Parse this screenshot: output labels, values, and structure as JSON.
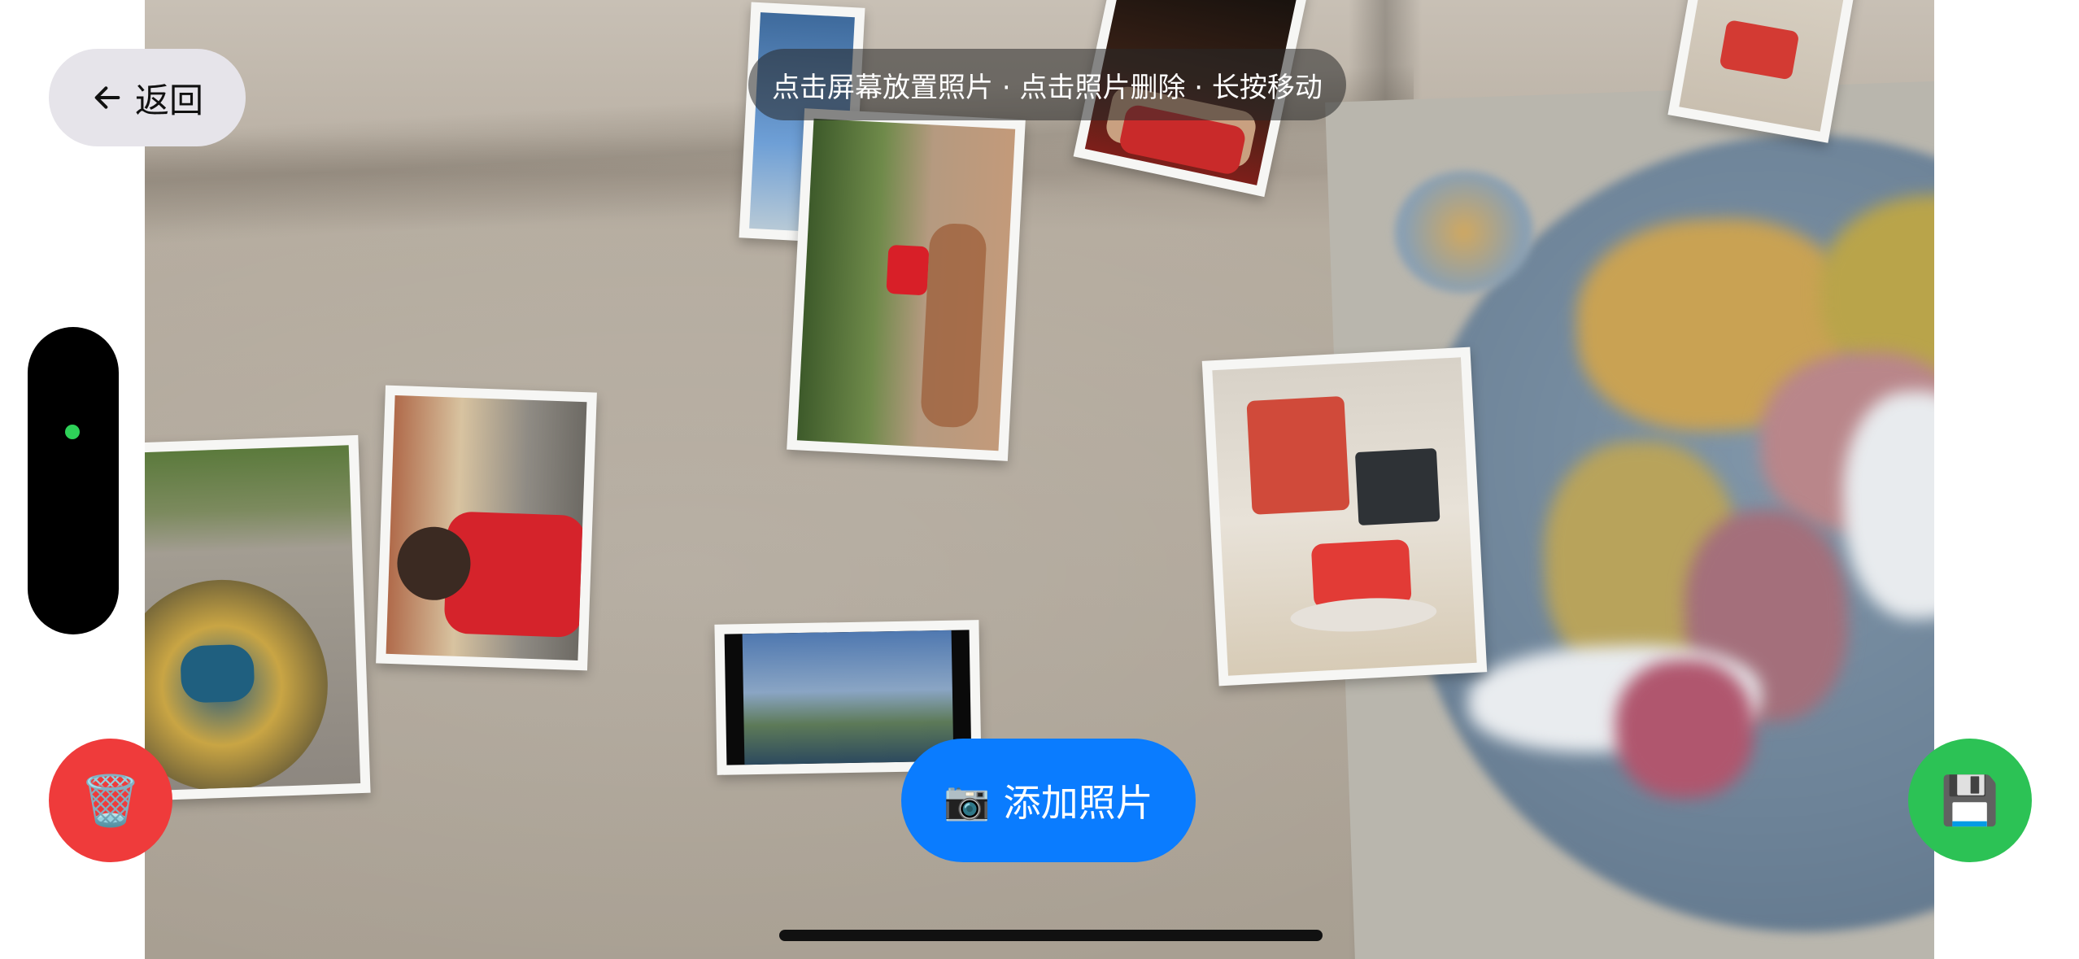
{
  "back_button": {
    "icon": "arrow-left-icon",
    "label": "返回"
  },
  "hint_text": "点击屏幕放置照片 · 点击照片删除 · 长按移动",
  "add_photo_button": {
    "icon": "camera-icon",
    "label": "添加照片"
  },
  "delete_button": {
    "icon": "trash-icon"
  },
  "save_button": {
    "icon": "floppy-disk-icon"
  },
  "status_indicator": {
    "color": "#2ed158"
  },
  "colors": {
    "add_photo_button": "#0a7cff",
    "delete_button": "#ef3b3b",
    "save_button": "#2cc255"
  }
}
